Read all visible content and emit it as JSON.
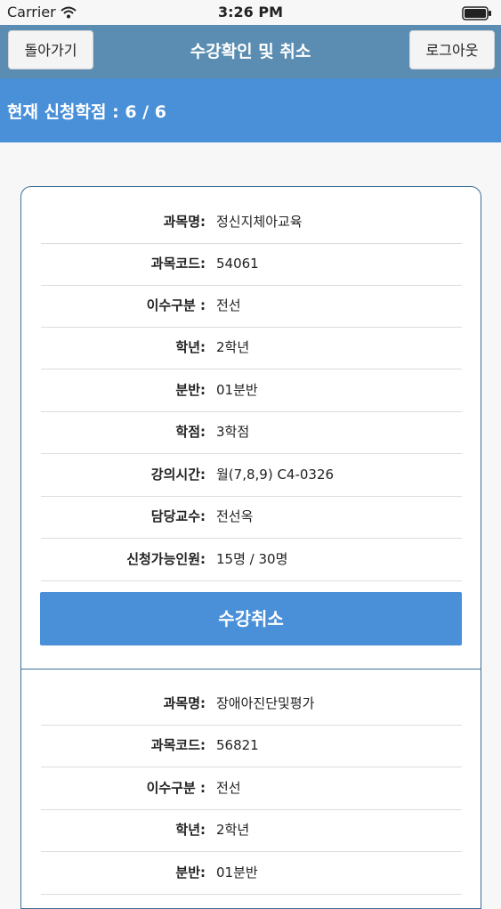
{
  "status_bar": {
    "carrier": "Carrier",
    "time": "3:26 PM"
  },
  "nav": {
    "back_label": "돌아가기",
    "title": "수강확인 및 취소",
    "logout_label": "로그아웃"
  },
  "banner": {
    "credit_text": "현재 신청학점 : 6 / 6"
  },
  "labels": {
    "subject": "과목명:",
    "code": "과목코드:",
    "category": "이수구분 :",
    "grade": "학년:",
    "section": "분반:",
    "credits": "학점:",
    "schedule": "강의시간:",
    "professor": "담당교수:",
    "capacity": "신청가능인원:"
  },
  "courses": [
    {
      "subject": "정신지체아교육",
      "code": "54061",
      "category": "전선",
      "grade": "2학년",
      "section": "01분반",
      "credits": "3학점",
      "schedule": "월(7,8,9) C4-0326",
      "professor": "전선옥",
      "capacity": "15명 / 30명",
      "cancel_label": "수강취소"
    },
    {
      "subject": "장애아진단및평가",
      "code": "56821",
      "category": "전선",
      "grade": "2학년",
      "section": "01분반"
    }
  ],
  "colors": {
    "nav": "#5a8db1",
    "banner": "#4a90d9",
    "button": "#4a90d9",
    "card_border": "#3e6f96"
  }
}
